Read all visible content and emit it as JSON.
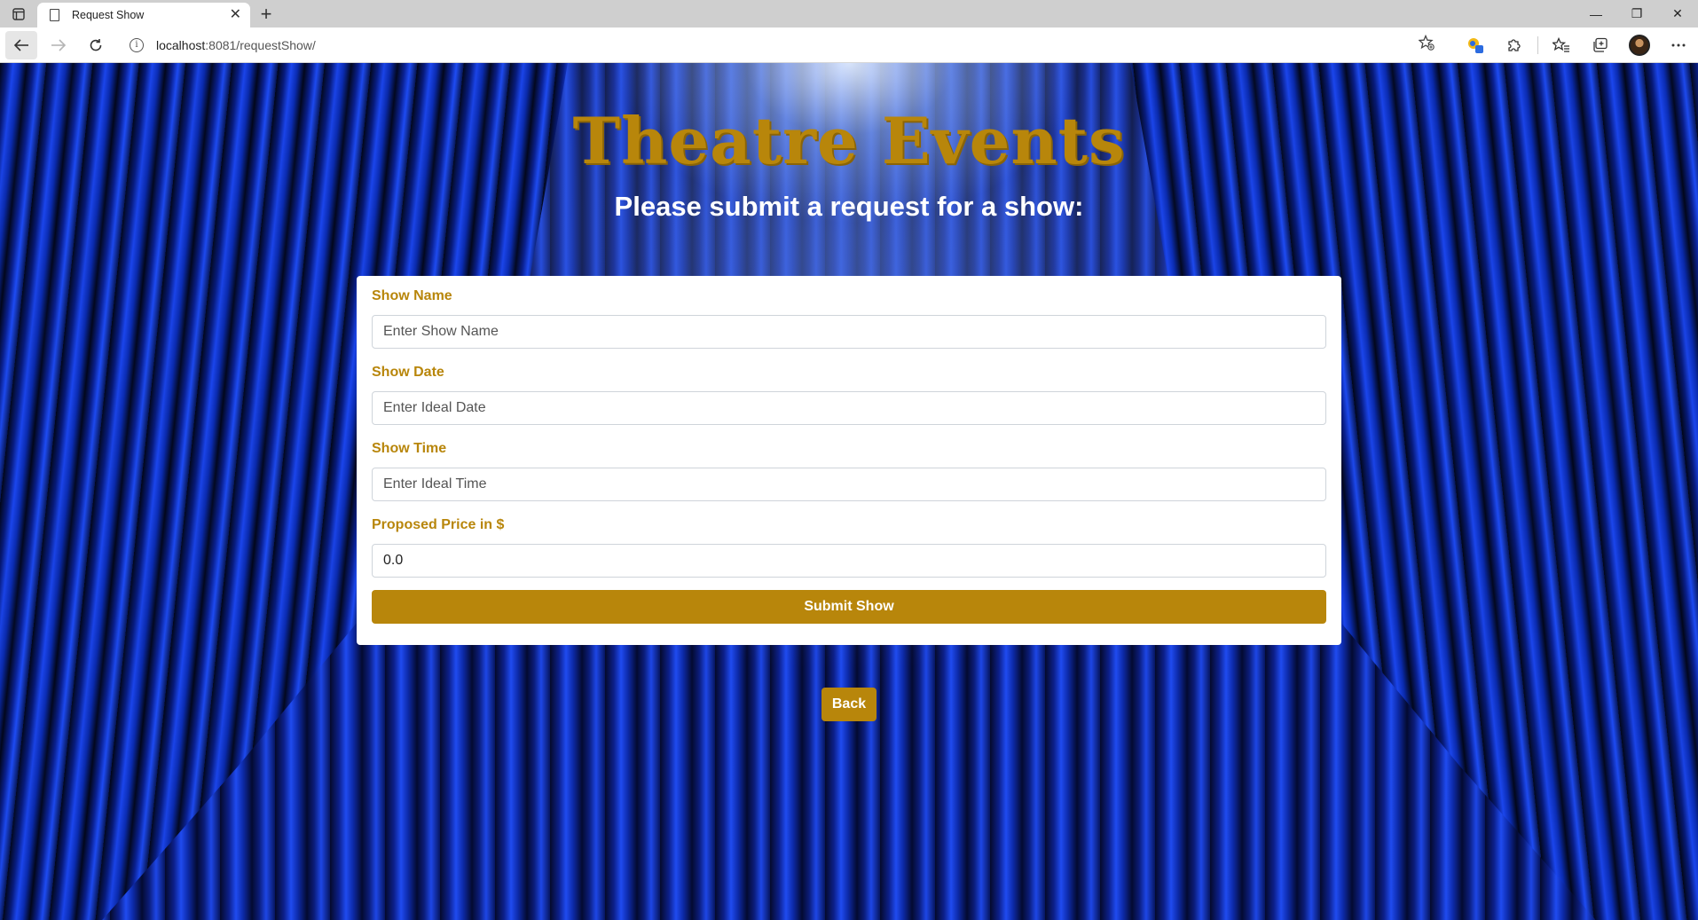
{
  "browser": {
    "tab_title": "Request Show",
    "tab_close": "✕",
    "new_tab": "+",
    "url_host": "localhost",
    "url_path": ":8081/requestShow/",
    "controls": {
      "minimize": "—",
      "restore": "❐",
      "close": "✕"
    },
    "icons": {
      "back": "back-arrow-icon",
      "forward": "forward-arrow-icon",
      "refresh": "refresh-icon",
      "info": "info-icon",
      "favorite": "star-add-icon",
      "extensions": "puzzle-icon",
      "favorites": "favorites-icon",
      "collections": "collections-icon",
      "profile": "avatar",
      "more": "more-icon"
    }
  },
  "page": {
    "title": "Theatre Events",
    "subtitle": "Please submit a request for a show:",
    "colors": {
      "accent": "#b8860b",
      "card": "#ffffff",
      "curtain": "#1d46e6"
    },
    "form": {
      "fields": [
        {
          "label": "Show Name",
          "placeholder": "Enter Show Name",
          "value": ""
        },
        {
          "label": "Show Date",
          "placeholder": "Enter Ideal Date",
          "value": ""
        },
        {
          "label": "Show Time",
          "placeholder": "Enter Ideal Time",
          "value": ""
        },
        {
          "label": "Proposed Price in $",
          "placeholder": "",
          "value": "0.0"
        }
      ],
      "submit_label": "Submit Show"
    },
    "back_label": "Back"
  }
}
